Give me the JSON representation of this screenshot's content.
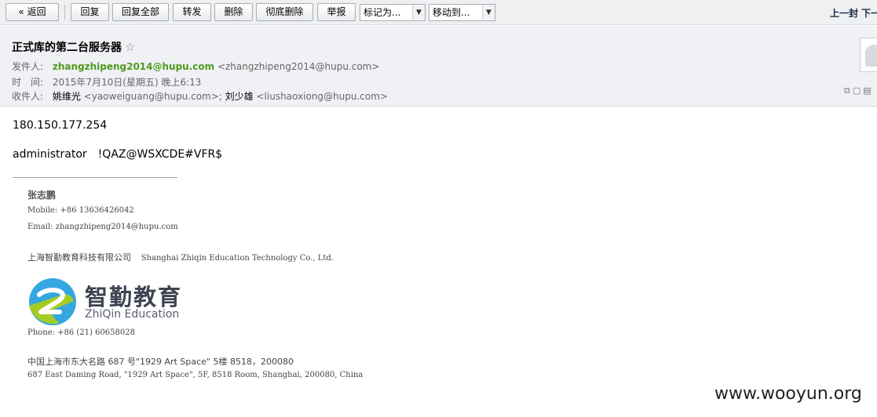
{
  "toolbar": {
    "back": "« 返回",
    "reply": "回复",
    "reply_all": "回复全部",
    "forward": "转发",
    "delete": "删除",
    "delete_permanent": "彻底删除",
    "report": "举报",
    "mark_as": "标记为...",
    "move_to": "移动到...",
    "prev": "上一封 下一"
  },
  "email": {
    "subject": "正式库的第二台服务器",
    "star": "☆",
    "from_label": "发件人:",
    "from_name": "zhangzhipeng2014@hupu.com",
    "from_addr": "<zhangzhipeng2014@hupu.com>",
    "time_label": "时　间:",
    "time": "2015年7月10日(星期五) 晚上6:13",
    "to_label": "收件人:",
    "to_1_name": "姚维光",
    "to_1_addr": "<yaoweiguang@hupu.com>;",
    "to_2_name": "刘少雄",
    "to_2_addr": "<liushaoxiong@hupu.com>",
    "header_icons": "⧉▢▤"
  },
  "body": {
    "line1": "180.150.177.254",
    "line2": "administrator　!QAZ@WSXCDE#VFR$"
  },
  "signature": {
    "name": "张志鹏",
    "mobile": "Mobile: +86 13636426042",
    "email": "Email: zhangzhipeng2014@hupu.com",
    "company_cn": "上海智勤教育科技有限公司",
    "company_en": "Shanghai Zhiqin Education Technology Co., Ltd.",
    "logo_cn": "智勤教育",
    "logo_en": "ZhiQin Education",
    "phone": "Phone: +86 (21) 60658028",
    "address_cn": "中国上海市东大名路 687 号\"1929 Art Space\" 5楼 8518，200080",
    "address_en": "687 East Daming Road, \"1929 Art Space\", 5F, 8518 Room, Shanghai, 200080, China"
  },
  "watermark": "www.wooyun.org",
  "colors": {
    "sender_green": "#4f9a1f",
    "logo_blue": "#35a7e0",
    "logo_green": "#a6cc22"
  }
}
